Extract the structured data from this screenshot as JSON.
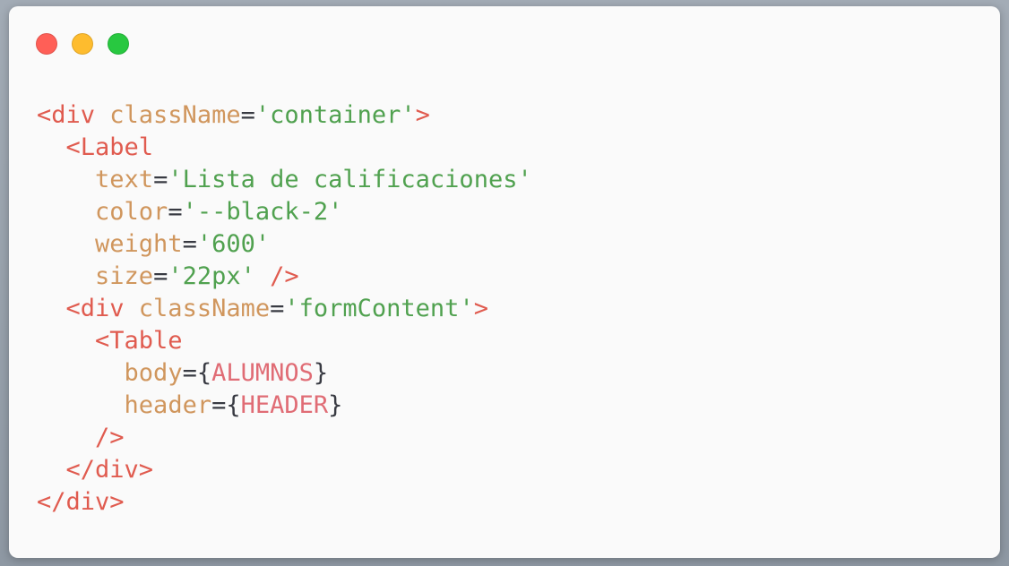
{
  "window": {
    "controls": [
      {
        "name": "close",
        "color": "#ff5f57"
      },
      {
        "name": "minimize",
        "color": "#febc2e"
      },
      {
        "name": "maximize",
        "color": "#28c840"
      }
    ]
  },
  "syntax_colors": {
    "tag": "#e05b4f",
    "attribute": "#d0965d",
    "string": "#50a14f",
    "punctuation": "#383a42",
    "variable": "#e06c75"
  },
  "code": {
    "lines": [
      {
        "tokens": [
          {
            "t": "tag",
            "v": "<div "
          },
          {
            "t": "attr",
            "v": "className"
          },
          {
            "t": "punc",
            "v": "="
          },
          {
            "t": "str",
            "v": "'container'"
          },
          {
            "t": "tag",
            "v": ">"
          }
        ]
      },
      {
        "tokens": [
          {
            "t": "punc",
            "v": "  "
          },
          {
            "t": "tag",
            "v": "<Label"
          }
        ]
      },
      {
        "tokens": [
          {
            "t": "punc",
            "v": "    "
          },
          {
            "t": "attr",
            "v": "text"
          },
          {
            "t": "punc",
            "v": "="
          },
          {
            "t": "str",
            "v": "'Lista de calificaciones'"
          }
        ]
      },
      {
        "tokens": [
          {
            "t": "punc",
            "v": "    "
          },
          {
            "t": "attr",
            "v": "color"
          },
          {
            "t": "punc",
            "v": "="
          },
          {
            "t": "str",
            "v": "'--black-2'"
          }
        ]
      },
      {
        "tokens": [
          {
            "t": "punc",
            "v": "    "
          },
          {
            "t": "attr",
            "v": "weight"
          },
          {
            "t": "punc",
            "v": "="
          },
          {
            "t": "str",
            "v": "'600'"
          }
        ]
      },
      {
        "tokens": [
          {
            "t": "punc",
            "v": "    "
          },
          {
            "t": "attr",
            "v": "size"
          },
          {
            "t": "punc",
            "v": "="
          },
          {
            "t": "str",
            "v": "'22px'"
          },
          {
            "t": "tag",
            "v": " />"
          }
        ]
      },
      {
        "tokens": [
          {
            "t": "punc",
            "v": "  "
          },
          {
            "t": "tag",
            "v": "<div "
          },
          {
            "t": "attr",
            "v": "className"
          },
          {
            "t": "punc",
            "v": "="
          },
          {
            "t": "str",
            "v": "'formContent'"
          },
          {
            "t": "tag",
            "v": ">"
          }
        ]
      },
      {
        "tokens": [
          {
            "t": "punc",
            "v": "    "
          },
          {
            "t": "tag",
            "v": "<Table"
          }
        ]
      },
      {
        "tokens": [
          {
            "t": "punc",
            "v": "      "
          },
          {
            "t": "attr",
            "v": "body"
          },
          {
            "t": "punc",
            "v": "={"
          },
          {
            "t": "var",
            "v": "ALUMNOS"
          },
          {
            "t": "punc",
            "v": "}"
          }
        ]
      },
      {
        "tokens": [
          {
            "t": "punc",
            "v": "      "
          },
          {
            "t": "attr",
            "v": "header"
          },
          {
            "t": "punc",
            "v": "={"
          },
          {
            "t": "var",
            "v": "HEADER"
          },
          {
            "t": "punc",
            "v": "}"
          }
        ]
      },
      {
        "tokens": [
          {
            "t": "punc",
            "v": "    "
          },
          {
            "t": "tag",
            "v": "/>"
          }
        ]
      },
      {
        "tokens": [
          {
            "t": "punc",
            "v": "  "
          },
          {
            "t": "tag",
            "v": "</div>"
          }
        ]
      },
      {
        "tokens": [
          {
            "t": "tag",
            "v": "</div>"
          }
        ]
      }
    ]
  }
}
